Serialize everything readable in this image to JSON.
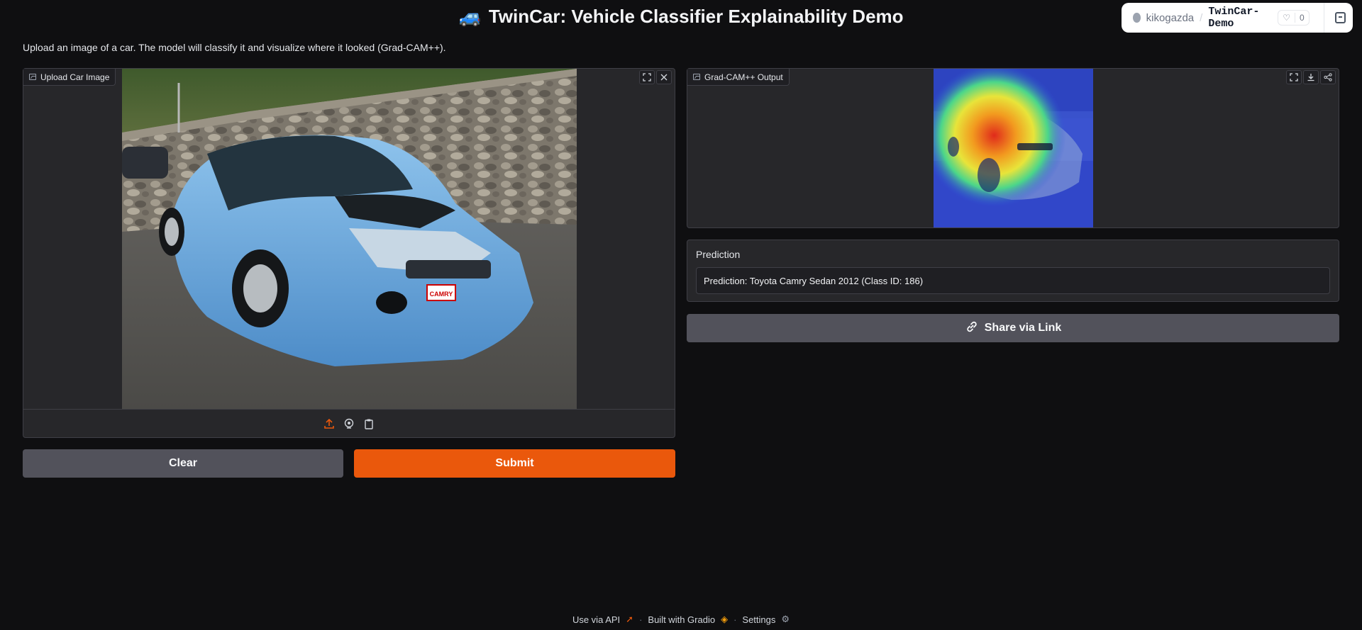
{
  "header": {
    "emoji": "🚙",
    "title": "TwinCar: Vehicle Classifier Explainability Demo",
    "description": "Upload an image of a car. The model will classify it and visualize where it looked (Grad-CAM++)."
  },
  "hf_badge": {
    "owner": "kikogazda",
    "repo": "TwinCar-Demo",
    "likes": "0"
  },
  "upload": {
    "label": "Upload Car Image",
    "sources": [
      "upload-icon",
      "webcam-icon",
      "clipboard-icon"
    ],
    "photo_plate": "CAMRY"
  },
  "actions": {
    "clear_label": "Clear",
    "submit_label": "Submit"
  },
  "gradcam": {
    "label": "Grad-CAM++ Output"
  },
  "prediction": {
    "label": "Prediction",
    "value": "Prediction: Toyota Camry Sedan 2012 (Class ID: 186)"
  },
  "share": {
    "label": "Share via Link"
  },
  "footer": {
    "api_label": "Use via API",
    "built_label": "Built with Gradio",
    "settings_label": "Settings"
  },
  "colors": {
    "accent": "#ea580c",
    "background": "#0f0f11",
    "panel": "#27272a"
  }
}
